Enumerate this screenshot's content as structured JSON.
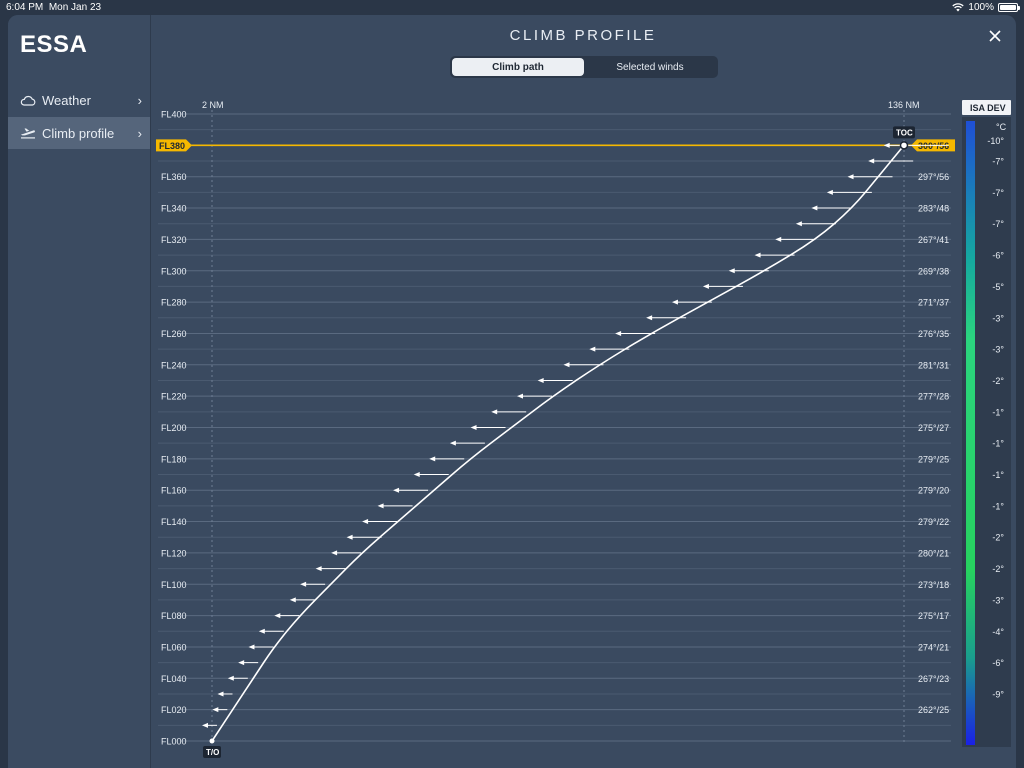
{
  "status_bar": {
    "time": "6:04 PM",
    "date": "Mon Jan 23",
    "battery": "100%"
  },
  "sidebar": {
    "airport": "ESSA",
    "items": [
      {
        "label": "Weather",
        "icon": "cloud-icon",
        "active": false
      },
      {
        "label": "Climb profile",
        "icon": "takeoff-icon",
        "active": true
      }
    ]
  },
  "header": {
    "title": "CLIMB PROFILE",
    "close_icon": "close-icon"
  },
  "tabs": [
    {
      "label": "Climb path",
      "active": true
    },
    {
      "label": "Selected winds",
      "active": false
    }
  ],
  "colors": {
    "accent": "#f5b800",
    "arrow": "#ffffff"
  },
  "chart": {
    "dist_start_label": "2 NM",
    "dist_end_label": "136 NM",
    "levels": [
      "FL400",
      "FL380",
      "FL360",
      "FL340",
      "FL320",
      "FL300",
      "FL280",
      "FL260",
      "FL240",
      "FL220",
      "FL200",
      "FL180",
      "FL160",
      "FL140",
      "FL120",
      "FL100",
      "FL080",
      "FL060",
      "FL040",
      "FL020",
      "FL000"
    ],
    "cruise_level": "FL380",
    "cruise_wind": "300°/56",
    "toc_label": "TOC",
    "to_label": "T/O",
    "winds": [
      {
        "fl": 360,
        "text": "297°/56"
      },
      {
        "fl": 340,
        "text": "283°/48"
      },
      {
        "fl": 320,
        "text": "267°/41"
      },
      {
        "fl": 300,
        "text": "269°/38"
      },
      {
        "fl": 280,
        "text": "271°/37"
      },
      {
        "fl": 260,
        "text": "276°/35"
      },
      {
        "fl": 240,
        "text": "281°/31"
      },
      {
        "fl": 220,
        "text": "277°/28"
      },
      {
        "fl": 200,
        "text": "275°/27"
      },
      {
        "fl": 180,
        "text": "279°/25"
      },
      {
        "fl": 160,
        "text": "279°/20"
      },
      {
        "fl": 140,
        "text": "279°/22"
      },
      {
        "fl": 120,
        "text": "280°/21"
      },
      {
        "fl": 100,
        "text": "273°/18"
      },
      {
        "fl": 80,
        "text": "275°/17"
      },
      {
        "fl": 60,
        "text": "274°/21"
      },
      {
        "fl": 40,
        "text": "267°/23"
      },
      {
        "fl": 20,
        "text": "262°/25"
      }
    ],
    "climb_profile": [
      {
        "fl": 0,
        "nm": 2
      },
      {
        "fl": 20,
        "nm": 6
      },
      {
        "fl": 40,
        "nm": 10
      },
      {
        "fl": 60,
        "nm": 14
      },
      {
        "fl": 80,
        "nm": 19
      },
      {
        "fl": 100,
        "nm": 25
      },
      {
        "fl": 120,
        "nm": 31
      },
      {
        "fl": 140,
        "nm": 38
      },
      {
        "fl": 160,
        "nm": 45
      },
      {
        "fl": 180,
        "nm": 52
      },
      {
        "fl": 200,
        "nm": 60
      },
      {
        "fl": 220,
        "nm": 68
      },
      {
        "fl": 240,
        "nm": 77
      },
      {
        "fl": 260,
        "nm": 87
      },
      {
        "fl": 280,
        "nm": 98
      },
      {
        "fl": 300,
        "nm": 109
      },
      {
        "fl": 320,
        "nm": 119
      },
      {
        "fl": 340,
        "nm": 126
      },
      {
        "fl": 360,
        "nm": 131
      },
      {
        "fl": 380,
        "nm": 136
      }
    ],
    "wind_arrows": [
      {
        "fl": 10,
        "nm": 2,
        "len": 3
      },
      {
        "fl": 20,
        "nm": 4,
        "len": 3
      },
      {
        "fl": 30,
        "nm": 5,
        "len": 3
      },
      {
        "fl": 40,
        "nm": 7,
        "len": 4
      },
      {
        "fl": 50,
        "nm": 9,
        "len": 4
      },
      {
        "fl": 60,
        "nm": 11,
        "len": 5
      },
      {
        "fl": 70,
        "nm": 13,
        "len": 5
      },
      {
        "fl": 80,
        "nm": 16,
        "len": 5
      },
      {
        "fl": 90,
        "nm": 19,
        "len": 5
      },
      {
        "fl": 100,
        "nm": 21,
        "len": 5
      },
      {
        "fl": 110,
        "nm": 24,
        "len": 6
      },
      {
        "fl": 120,
        "nm": 27,
        "len": 6
      },
      {
        "fl": 130,
        "nm": 30,
        "len": 7
      },
      {
        "fl": 140,
        "nm": 33,
        "len": 7
      },
      {
        "fl": 150,
        "nm": 36,
        "len": 7
      },
      {
        "fl": 160,
        "nm": 39,
        "len": 7
      },
      {
        "fl": 170,
        "nm": 43,
        "len": 7
      },
      {
        "fl": 180,
        "nm": 46,
        "len": 7
      },
      {
        "fl": 190,
        "nm": 50,
        "len": 7
      },
      {
        "fl": 200,
        "nm": 54,
        "len": 7
      },
      {
        "fl": 210,
        "nm": 58,
        "len": 7
      },
      {
        "fl": 220,
        "nm": 63,
        "len": 7
      },
      {
        "fl": 230,
        "nm": 67,
        "len": 7
      },
      {
        "fl": 240,
        "nm": 72,
        "len": 8
      },
      {
        "fl": 250,
        "nm": 77,
        "len": 8
      },
      {
        "fl": 260,
        "nm": 82,
        "len": 8
      },
      {
        "fl": 270,
        "nm": 88,
        "len": 8
      },
      {
        "fl": 280,
        "nm": 93,
        "len": 8
      },
      {
        "fl": 290,
        "nm": 99,
        "len": 8
      },
      {
        "fl": 300,
        "nm": 104,
        "len": 8
      },
      {
        "fl": 310,
        "nm": 109,
        "len": 8
      },
      {
        "fl": 320,
        "nm": 113,
        "len": 8
      },
      {
        "fl": 330,
        "nm": 117,
        "len": 8
      },
      {
        "fl": 340,
        "nm": 120,
        "len": 8
      },
      {
        "fl": 350,
        "nm": 123,
        "len": 9
      },
      {
        "fl": 360,
        "nm": 127,
        "len": 9
      },
      {
        "fl": 370,
        "nm": 131,
        "len": 9
      },
      {
        "fl": 380,
        "nm": 134,
        "len": 13
      }
    ]
  },
  "isa": {
    "header": "ISA DEV",
    "unit": "°C",
    "labels": [
      "-10°",
      "-7°",
      "-7°",
      "-7°",
      "-6°",
      "-5°",
      "-3°",
      "-3°",
      "-2°",
      "-1°",
      "-1°",
      "-1°",
      "-1°",
      "-2°",
      "-2°",
      "-3°",
      "-4°",
      "-6°",
      "-9°"
    ]
  }
}
